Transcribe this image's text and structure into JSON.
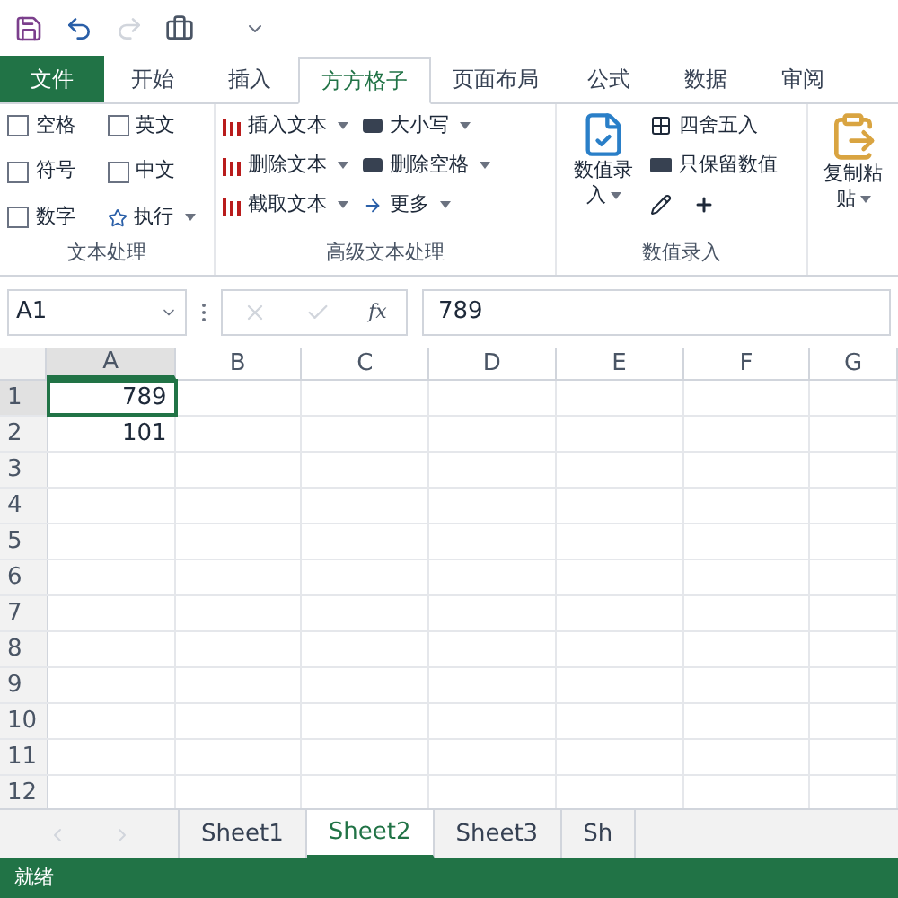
{
  "ribbon_tabs": [
    {
      "label": "文件",
      "kind": "file",
      "selected": false
    },
    {
      "label": "开始",
      "kind": "tab",
      "selected": false
    },
    {
      "label": "插入",
      "kind": "tab",
      "selected": false
    },
    {
      "label": "方方格子",
      "kind": "tab",
      "selected": true
    },
    {
      "label": "页面布局",
      "kind": "tab",
      "selected": false
    },
    {
      "label": "公式",
      "kind": "tab",
      "selected": false
    },
    {
      "label": "数据",
      "kind": "tab",
      "selected": false
    },
    {
      "label": "审阅",
      "kind": "tab",
      "selected": false
    }
  ],
  "text_group": {
    "title": "文本处理",
    "checkboxes": [
      {
        "label": "空格",
        "checked": false
      },
      {
        "label": "英文",
        "checked": false
      },
      {
        "label": "符号",
        "checked": false
      },
      {
        "label": "中文",
        "checked": false
      },
      {
        "label": "数字",
        "checked": false
      }
    ],
    "run_button": "执行"
  },
  "advanced_group": {
    "title": "高级文本处理",
    "left": [
      "插入文本",
      "删除文本",
      "截取文本"
    ],
    "right": [
      "大小写",
      "删除空格",
      "更多"
    ]
  },
  "number_group": {
    "title": "数值录入",
    "big_button": [
      "数值录",
      "入"
    ],
    "round": "四舍五入",
    "keep_values": "只保留数值"
  },
  "paste_button": [
    "复制粘",
    "贴"
  ],
  "name_box": "A1",
  "function_label": "fx",
  "formula": "789",
  "columns": [
    "A",
    "B",
    "C",
    "D",
    "E",
    "F",
    "G"
  ],
  "rows": [
    {
      "header": "1",
      "cells": [
        "789"
      ],
      "selected": true
    },
    {
      "header": "2",
      "cells": [
        "101"
      ],
      "selected": false
    },
    {
      "header": "3",
      "cells": [],
      "selected": false
    },
    {
      "header": "4",
      "cells": [],
      "selected": false
    },
    {
      "header": "5",
      "cells": [],
      "selected": false
    },
    {
      "header": "6",
      "cells": [],
      "selected": false
    },
    {
      "header": "7",
      "cells": [],
      "selected": false
    },
    {
      "header": "8",
      "cells": [],
      "selected": false
    },
    {
      "header": "9",
      "cells": [],
      "selected": false
    },
    {
      "header": "10",
      "cells": [],
      "selected": false
    },
    {
      "header": "11",
      "cells": [],
      "selected": false
    },
    {
      "header": "12",
      "cells": [],
      "selected": false
    }
  ],
  "sheet_tabs": [
    {
      "label": "Sheet1",
      "selected": false
    },
    {
      "label": "Sheet2",
      "selected": true
    },
    {
      "label": "Sheet3",
      "selected": false
    },
    {
      "label": "Sh",
      "selected": false
    }
  ],
  "status_bar": "就绪"
}
